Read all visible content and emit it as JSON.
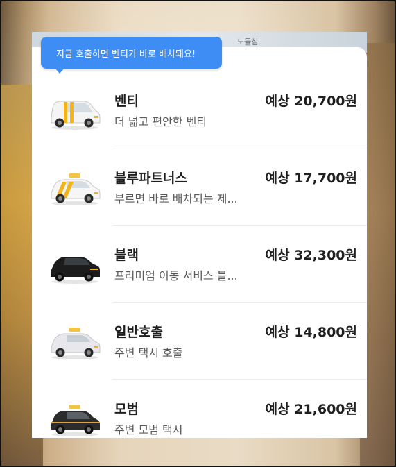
{
  "map": {
    "label": "노들섬"
  },
  "tooltip": {
    "text": "지금 호출하면 벤티가 바로 배차돼요!"
  },
  "options": [
    {
      "name": "벤티",
      "description": "더 넓고 편안한 벤티",
      "price": "예상 20,700원",
      "car_icon": "venti-van-icon"
    },
    {
      "name": "블루파트너스",
      "description": "부르면 바로 배차되는 제...",
      "price": "예상 17,700원",
      "car_icon": "blue-taxi-icon"
    },
    {
      "name": "블랙",
      "description": "프리미엄 이동 서비스 블...",
      "price": "예상 32,300원",
      "car_icon": "black-sedan-icon"
    },
    {
      "name": "일반호출",
      "description": "주변 택시 호출",
      "price": "예상 14,800원",
      "car_icon": "standard-taxi-icon"
    },
    {
      "name": "모범",
      "description": "주변 모범 택시",
      "price": "예상 21,600원",
      "car_icon": "deluxe-taxi-icon"
    }
  ],
  "colors": {
    "tooltip": "#3d8df5",
    "venti_stripe": "#f2b31b",
    "taxi_sign": "#f5c542",
    "black_car": "#1c1c1c"
  }
}
